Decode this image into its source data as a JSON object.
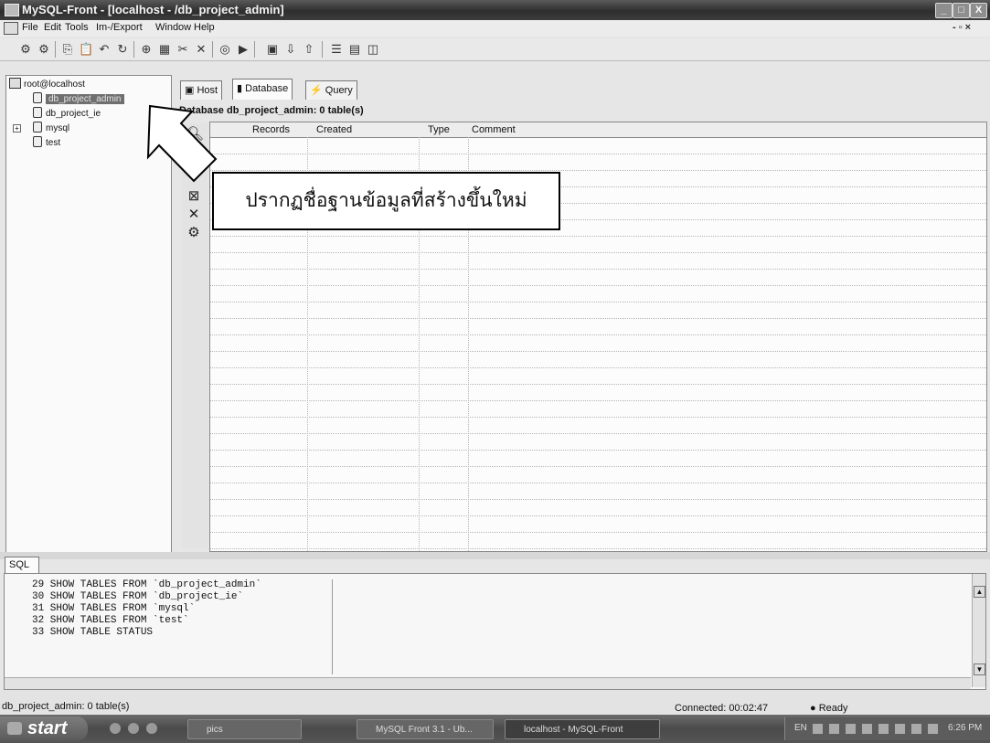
{
  "window": {
    "title": "MySQL-Front - [localhost - /db_project_admin]",
    "minimize": "_",
    "maximize": "□",
    "close": "X"
  },
  "menu": {
    "items": [
      "File",
      "Edit",
      "Tools",
      "Im-/Export",
      "Window",
      "Help"
    ],
    "mdi_controls": "- ▫ ×"
  },
  "tree": {
    "root": "root@localhost",
    "databases": [
      {
        "name": "db_project_admin",
        "selected": true
      },
      {
        "name": "db_project_ie"
      },
      {
        "name": "mysql",
        "expandable": true
      },
      {
        "name": "test"
      }
    ]
  },
  "tabs": [
    {
      "label": "Host"
    },
    {
      "label": "Database",
      "active": true
    },
    {
      "label": "Query"
    }
  ],
  "database_view": {
    "title": "Database db_project_admin: 0 table(s)",
    "columns": [
      "Records",
      "Created",
      "Type",
      "Comment"
    ]
  },
  "callout": {
    "text": "ปรากฏชื่อฐานข้อมูลที่สร้างขึ้นใหม่"
  },
  "sql_panel": {
    "tab_label": "SQL",
    "log": [
      "29 SHOW TABLES FROM `db_project_admin`",
      "30 SHOW TABLES FROM `db_project_ie`",
      "31 SHOW TABLES FROM `mysql`",
      "32 SHOW TABLES FROM `test`",
      "33 SHOW TABLE STATUS"
    ]
  },
  "status": {
    "left": "db_project_admin: 0 table(s)",
    "connected": "Connected: 00:02:47",
    "ready": "Ready"
  },
  "taskbar": {
    "start": "start",
    "tasks": [
      "pics",
      "MySQL Front 3.1 - Ub...",
      "localhost - MySQL-Front"
    ],
    "clock": "6:26 PM",
    "lang": "EN"
  }
}
